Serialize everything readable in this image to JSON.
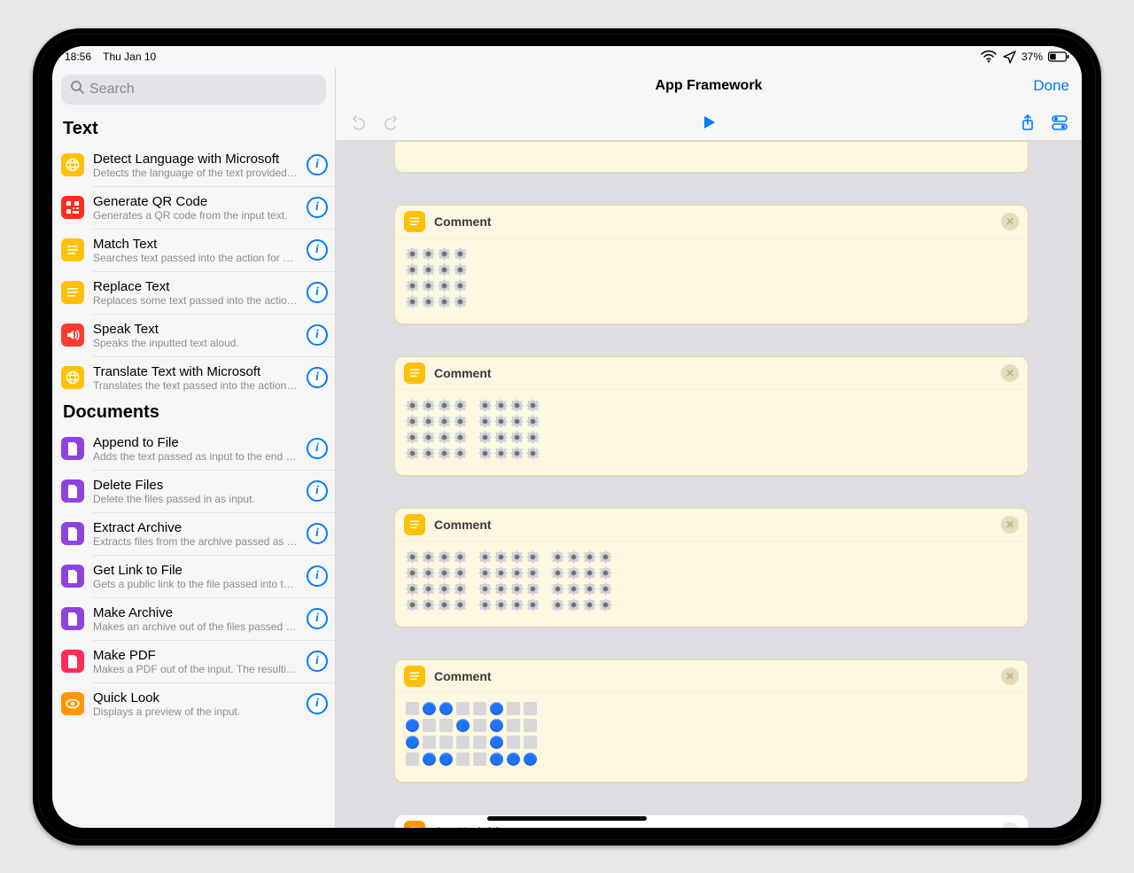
{
  "status": {
    "time": "18:56",
    "date": "Thu Jan 10",
    "battery": "37%"
  },
  "search": {
    "placeholder": "Search"
  },
  "sidebar": {
    "sections": [
      {
        "title": "Text",
        "items": [
          {
            "title": "Detect Language with Microsoft",
            "sub": "Detects the language of the text provided as...",
            "iconClass": "ic-yellow",
            "iconName": "globe-icon"
          },
          {
            "title": "Generate QR Code",
            "sub": "Generates a QR code from the input text.",
            "iconClass": "ic-redqr",
            "iconName": "qrcode-icon"
          },
          {
            "title": "Match Text",
            "sub": "Searches text passed into the action for matc...",
            "iconClass": "ic-yellow",
            "iconName": "lines-icon"
          },
          {
            "title": "Replace Text",
            "sub": "Replaces some text passed into the action wi...",
            "iconClass": "ic-yellow",
            "iconName": "lines-icon"
          },
          {
            "title": "Speak Text",
            "sub": "Speaks the inputted text aloud.",
            "iconClass": "ic-red",
            "iconName": "speaker-icon"
          },
          {
            "title": "Translate Text with Microsoft",
            "sub": "Translates the text passed into the action int...",
            "iconClass": "ic-yellow",
            "iconName": "globe-icon"
          }
        ]
      },
      {
        "title": "Documents",
        "items": [
          {
            "title": "Append to File",
            "sub": "Adds the text passed as input to the end of t...",
            "iconClass": "ic-purple",
            "iconName": "file-icon"
          },
          {
            "title": "Delete Files",
            "sub": "Delete the files passed in as input.",
            "iconClass": "ic-purple",
            "iconName": "file-icon"
          },
          {
            "title": "Extract Archive",
            "sub": "Extracts files from the archive passed as inp...",
            "iconClass": "ic-purple",
            "iconName": "file-icon"
          },
          {
            "title": "Get Link to File",
            "sub": "Gets a public link to the file passed into the a...",
            "iconClass": "ic-purple",
            "iconName": "file-icon"
          },
          {
            "title": "Make Archive",
            "sub": "Makes an archive out of the files passed as in...",
            "iconClass": "ic-purple",
            "iconName": "file-icon"
          },
          {
            "title": "Make PDF",
            "sub": "Makes a PDF out of the input. The resulting P...",
            "iconClass": "ic-pink",
            "iconName": "file-icon"
          },
          {
            "title": "Quick Look",
            "sub": "Displays a preview of the input.",
            "iconClass": "ic-orange",
            "iconName": "eye-icon"
          }
        ]
      }
    ]
  },
  "editor": {
    "title": "App Framework",
    "done": "Done",
    "blocks": [
      {
        "type": "stub"
      },
      {
        "type": "comment",
        "label": "Comment",
        "gears": [
          [
            4
          ],
          [
            4
          ],
          [
            4
          ],
          [
            4
          ]
        ]
      },
      {
        "type": "comment",
        "label": "Comment",
        "gears": [
          [
            4,
            4
          ],
          [
            4,
            4
          ],
          [
            4,
            4
          ],
          [
            4,
            4
          ]
        ]
      },
      {
        "type": "comment",
        "label": "Comment",
        "gears": [
          [
            4,
            4,
            4
          ],
          [
            4,
            4,
            4
          ],
          [
            4,
            4,
            4
          ],
          [
            4,
            4,
            4
          ]
        ]
      },
      {
        "type": "pixel-comment",
        "label": "Comment",
        "pixels": [
          [
            0,
            1,
            1,
            0,
            0,
            1,
            0,
            0
          ],
          [
            1,
            0,
            0,
            1,
            0,
            1,
            0,
            0
          ],
          [
            1,
            0,
            0,
            0,
            0,
            1,
            0,
            0
          ],
          [
            0,
            1,
            1,
            0,
            0,
            1,
            1,
            1
          ]
        ]
      },
      {
        "type": "getvar",
        "label": "Get Variable"
      }
    ]
  }
}
